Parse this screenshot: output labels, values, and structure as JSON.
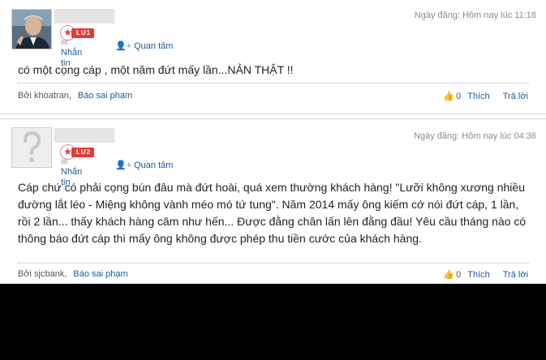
{
  "posts": [
    {
      "date": "Ngày đăng: Hôm nay lúc 11:18",
      "level": "LU1",
      "message_label": "Nhắn tin",
      "follow_label": "Quan tâm",
      "content": "có một cọng cáp , một năm đứt mấy lần...NẢN THẬT !!",
      "by_label": "Bởi khoatran,",
      "report_label": "Báo sai phạm",
      "likes": "0",
      "like_label": "Thích",
      "reply_label": "Trả lời"
    },
    {
      "date": "Ngày đăng: Hôm nay lúc 04:36",
      "level": "LU2",
      "message_label": "Nhắn tin",
      "follow_label": "Quan tâm",
      "content": "Cáp chứ có phải cọng bún đâu mà đứt hoài, quá xem thường khách hàng! \"Lưỡi không xương nhiều đường lắt léo - Miệng không vành méo mó tứ tung\". Năm 2014 mấy ông kiếm cớ nói đứt cáp, 1 lần, rồi 2 lần... thấy khách hàng câm như hến... Được đằng chân lấn lên đằng đầu! Yêu cầu tháng nào có thông báo đứt cáp thì mấy ông không được phép thu tiền cước của khách hàng.",
      "by_label": "Bởi sjcbank,",
      "report_label": "Báo sai phạm",
      "likes": "0",
      "like_label": "Thích",
      "reply_label": "Trả lời"
    }
  ],
  "icons": {
    "avatar_placeholder": "question-mark",
    "message": "envelope",
    "follow": "user-plus",
    "like": "thumbs-up",
    "badge": "star"
  },
  "colors": {
    "link": "#1a5a9a",
    "badge": "#e23b3b"
  }
}
